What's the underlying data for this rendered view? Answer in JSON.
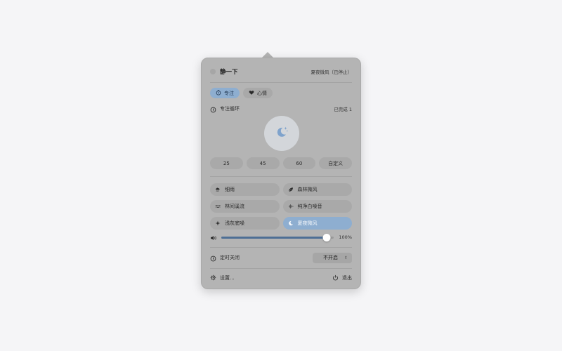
{
  "header": {
    "title": "静一下",
    "status": "夏夜微风（已停止）"
  },
  "tabs": [
    {
      "label": "专注",
      "icon": "timer-icon",
      "active": true
    },
    {
      "label": "心情",
      "icon": "heart-icon",
      "active": false
    }
  ],
  "focus": {
    "label": "专注循环",
    "completed": "已完成 1"
  },
  "center_icon": "moon-stars-icon",
  "durations": [
    "25",
    "45",
    "60",
    "自定义"
  ],
  "sounds": [
    {
      "label": "细雨",
      "icon": "cloud-rain-icon",
      "active": false
    },
    {
      "label": "森林微风",
      "icon": "leaf-icon",
      "active": false
    },
    {
      "label": "林间溪流",
      "icon": "waves-icon",
      "active": false
    },
    {
      "label": "纯净白噪音",
      "icon": "waveform-icon",
      "active": false
    },
    {
      "label": "浅灰底噪",
      "icon": "sparkle-icon",
      "active": false
    },
    {
      "label": "夏夜微风",
      "icon": "moon-icon",
      "active": true
    }
  ],
  "volume": {
    "percent_label": "100%",
    "value": 100
  },
  "timer": {
    "label": "定时关闭",
    "value": "不开启"
  },
  "footer": {
    "settings": "设置...",
    "quit": "退出"
  },
  "colors": {
    "accent": "#8eaed0",
    "slider_fill": "#4e6f95",
    "panel": "#b4b4b4"
  }
}
